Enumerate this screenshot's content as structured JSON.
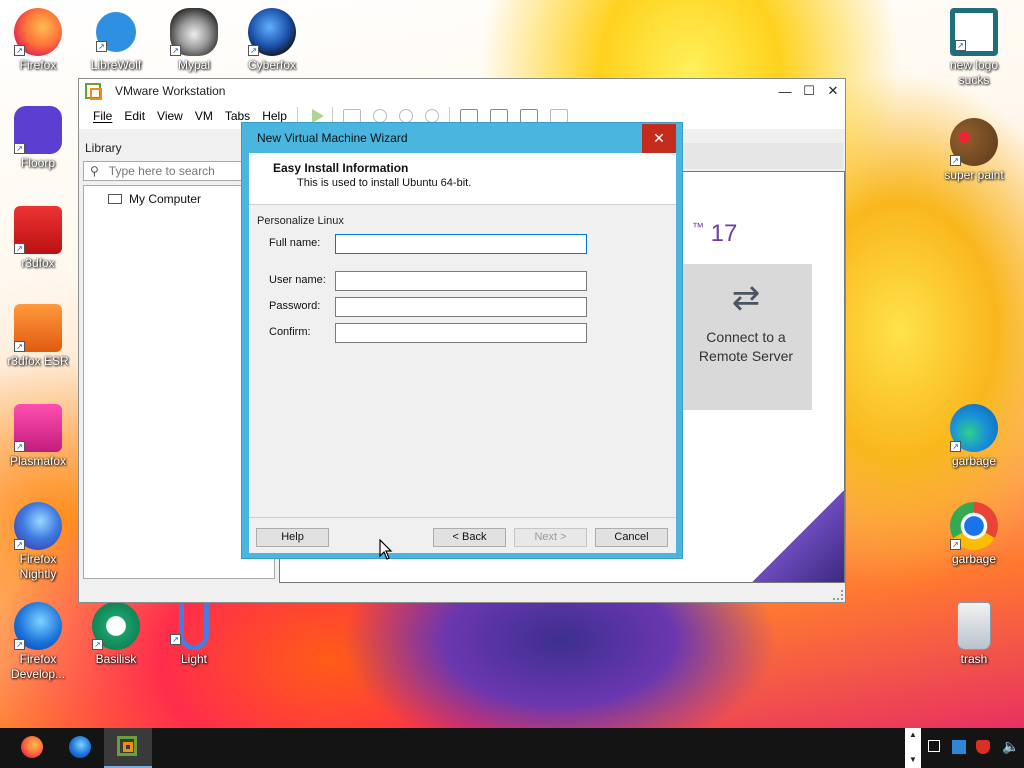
{
  "desktop": {
    "left_icons": [
      {
        "label": "Firefox",
        "icon": "firefox-icon"
      },
      {
        "label": "Floorp",
        "icon": "floorp-icon"
      },
      {
        "label": "r3dfox",
        "icon": "r3dfox-icon"
      },
      {
        "label": "r3dfox ESR",
        "icon": "r3dfox-esr-icon"
      },
      {
        "label": "Plasmafox",
        "icon": "plasmafox-icon"
      },
      {
        "label": "Firefox Nightly",
        "icon": "firefox-nightly-icon"
      },
      {
        "label": "Firefox Develop...",
        "icon": "firefox-developer-icon"
      }
    ],
    "top_icons": [
      {
        "label": "LibreWolf",
        "icon": "librewolf-icon"
      },
      {
        "label": "Mypal",
        "icon": "mypal-icon"
      },
      {
        "label": "Cyberfox",
        "icon": "cyberfox-icon"
      }
    ],
    "bottom_icons": [
      {
        "label": "Basilisk",
        "icon": "basilisk-icon"
      },
      {
        "label": "Light",
        "icon": "light-icon"
      }
    ],
    "right_icons": [
      {
        "label": "new logo sucks",
        "icon": "vs-logo-icon"
      },
      {
        "label": "super paint",
        "icon": "palette-icon"
      },
      {
        "label": "garbage",
        "icon": "edge-icon"
      },
      {
        "label": "garbage",
        "icon": "chrome-icon"
      },
      {
        "label": "trash",
        "icon": "recycle-bin-icon"
      }
    ]
  },
  "vmware": {
    "title": "VMware Workstation",
    "menu": [
      "File",
      "Edit",
      "View",
      "VM",
      "Tabs",
      "Help"
    ],
    "library_title": "Library",
    "search_placeholder": "Type here to search",
    "tree_item": "My Computer",
    "home": {
      "version_text": "17",
      "connect_label_1": "Connect to a",
      "connect_label_2": "Remote Server"
    }
  },
  "wizard": {
    "title": "New Virtual Machine Wizard",
    "close": "✕",
    "header_title": "Easy Install Information",
    "header_subtitle": "This is used to install Ubuntu 64-bit.",
    "section": "Personalize Linux",
    "fields": {
      "full_name_label": "Full name:",
      "full_name_value": "",
      "user_name_label": "User name:",
      "user_name_value": "",
      "password_label": "Password:",
      "password_value": "",
      "confirm_label": "Confirm:",
      "confirm_value": ""
    },
    "buttons": {
      "help": "Help",
      "back": "< Back",
      "next": "Next >",
      "cancel": "Cancel"
    }
  },
  "colors": {
    "dialog_border": "#4ab5de",
    "close_button": "#c42b1c",
    "taskbar": "#141414"
  }
}
